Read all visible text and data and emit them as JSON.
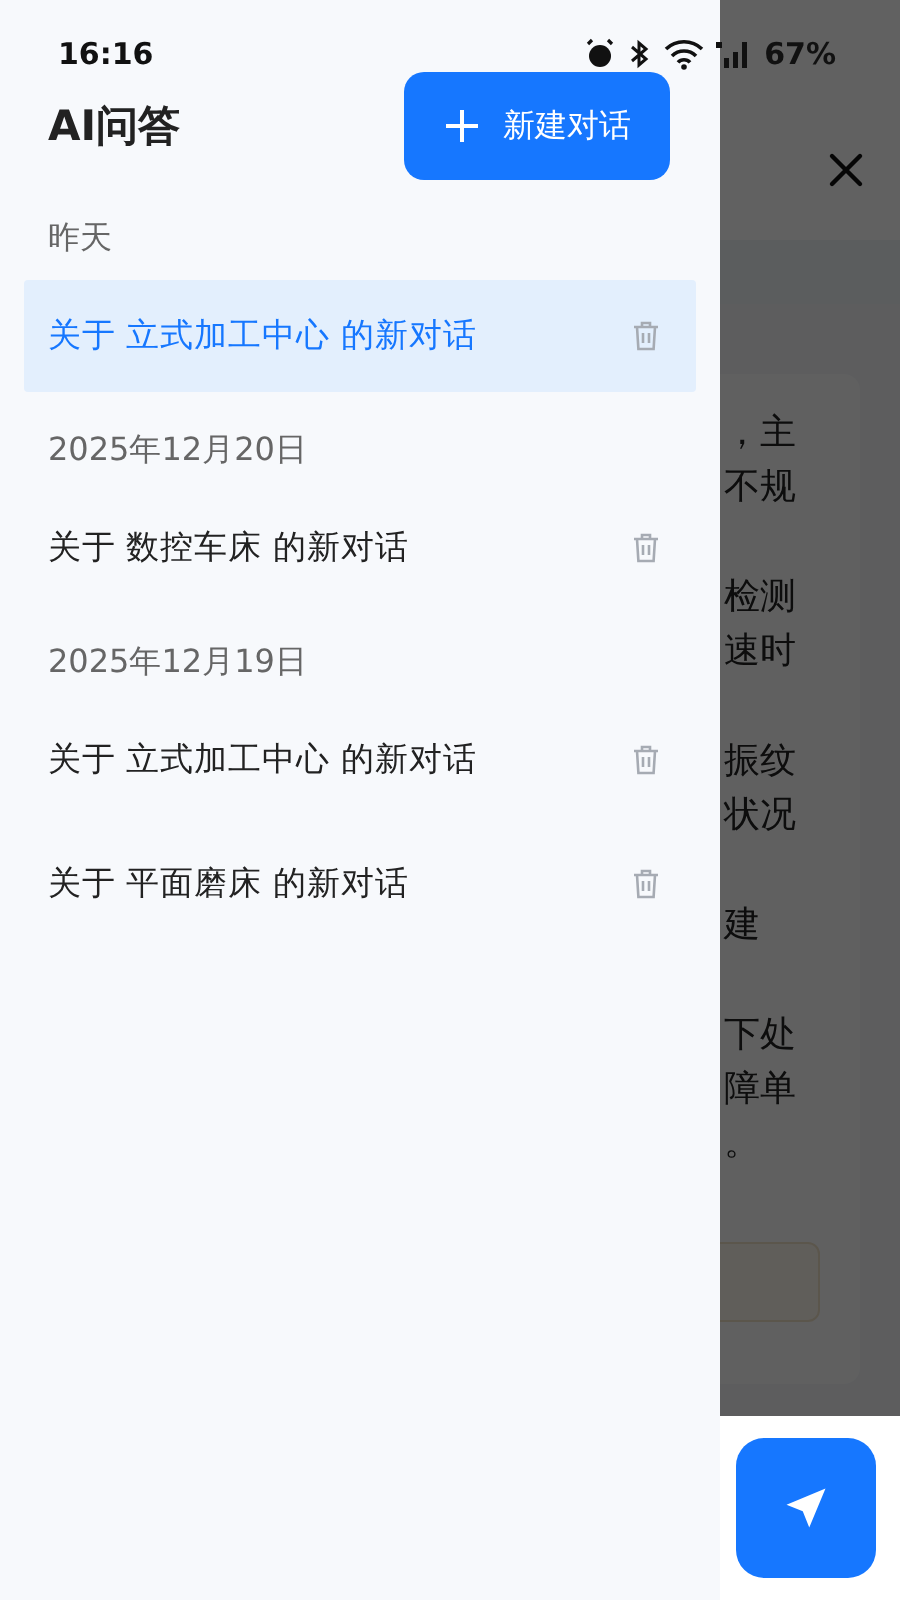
{
  "status_bar": {
    "time": "16:16",
    "battery": "67%"
  },
  "drawer": {
    "title": "AI问答",
    "new_button": "新建对话",
    "groups": [
      {
        "label": "昨天",
        "items": [
          {
            "title": "关于 立式加工中心 的新对话",
            "selected": true
          }
        ]
      },
      {
        "label": "2025年12月20日",
        "items": [
          {
            "title": "关于 数控车床 的新对话",
            "selected": false
          }
        ]
      },
      {
        "label": "2025年12月19日",
        "items": [
          {
            "title": "关于 立式加工中心 的新对话",
            "selected": false
          },
          {
            "title": "关于 平面磨床 的新对话",
            "selected": false
          }
        ]
      }
    ]
  },
  "background": {
    "paragraphs": [
      [
        "，主",
        "不规"
      ],
      [
        "检测",
        "速时"
      ],
      [
        "振纹",
        "状况"
      ],
      [
        "建"
      ],
      [
        "下处",
        "障单",
        "。"
      ]
    ]
  }
}
